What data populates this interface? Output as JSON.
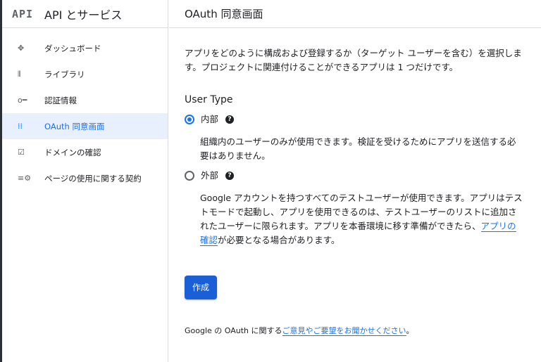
{
  "brand": {
    "logo": "API",
    "title": "API とサービス"
  },
  "nav": [
    {
      "icon": "✥",
      "label": "ダッシュボード"
    },
    {
      "icon": "⫴",
      "label": "ライブラリ"
    },
    {
      "icon": "o━",
      "label": "認証情報"
    },
    {
      "icon": "⁞⁞",
      "label": "OAuth 同意画面"
    },
    {
      "icon": "☑",
      "label": "ドメインの確認"
    },
    {
      "icon": "≡⚙",
      "label": "ページの使用に関する契約"
    }
  ],
  "header": {
    "title": "OAuth 同意画面"
  },
  "main": {
    "intro": "アプリをどのように構成および登録するか（ターゲット ユーザーを含む）を選択します。プロジェクトに関連付けることができるアプリは 1 つだけです。",
    "user_type": "User Type",
    "internal": {
      "label": "内部",
      "desc": "組織内のユーザーのみが使用できます。検証を受けるためにアプリを送信する必要はありません。"
    },
    "external": {
      "label": "外部",
      "desc": "Google アカウントを持つすべてのテストユーザーが使用できます。アプリはテストモードで起動し、アプリを使用できるのは、テストユーザーのリストに追加されたユーザーに限られます。アプリを本番環境に移す準備ができたら、",
      "link": "アプリの確認",
      "desc_end": "が必要となる場合があります。"
    },
    "help": "?",
    "create": "作成"
  },
  "footer": {
    "text": "Google の OAuth に関する",
    "link": "ご意見やご要望をお聞かせください",
    "end": "。"
  }
}
